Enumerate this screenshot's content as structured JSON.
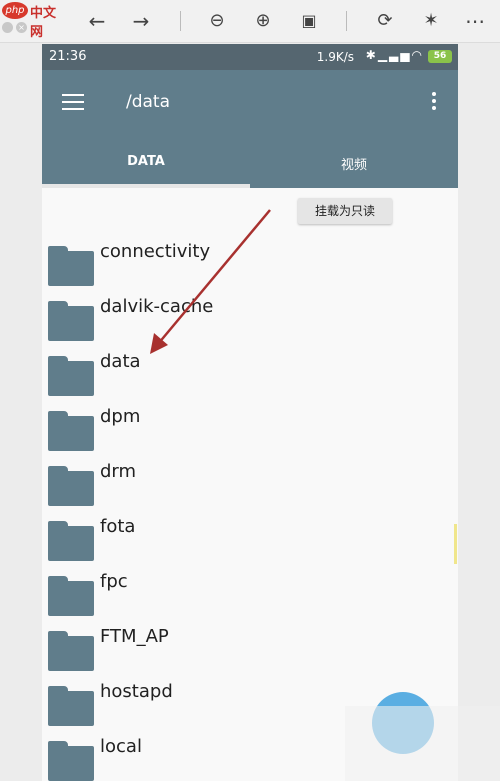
{
  "viewer": {
    "logo_php": "php",
    "logo_cn": "中文网",
    "toolbar_icons": [
      "back-arrow-icon",
      "forward-arrow-icon",
      "zoom-out-icon",
      "zoom-in-icon",
      "fit-page-icon",
      "rotate-icon",
      "magic-wand-icon",
      "more-horizontal-icon"
    ]
  },
  "status": {
    "time": "21:36",
    "net_speed": "1.9K/s",
    "battery": "56"
  },
  "appbar": {
    "path_title": "/data",
    "tabs": [
      {
        "label": "DATA",
        "active": true
      },
      {
        "label": "视频",
        "active": false
      }
    ]
  },
  "tooltip": {
    "label": "挂载为只读"
  },
  "files": [
    {
      "name": "connectivity"
    },
    {
      "name": "dalvik-cache"
    },
    {
      "name": "data"
    },
    {
      "name": "dpm"
    },
    {
      "name": "drm"
    },
    {
      "name": "fota"
    },
    {
      "name": "fpc"
    },
    {
      "name": "FTM_AP"
    },
    {
      "name": "hostapd"
    },
    {
      "name": "local"
    }
  ],
  "colors": {
    "appbar": "#607d8b",
    "statusbar": "#556670",
    "folder": "#607d8b",
    "fab": "#5aaee2",
    "annotation_arrow": "#a8312f"
  }
}
